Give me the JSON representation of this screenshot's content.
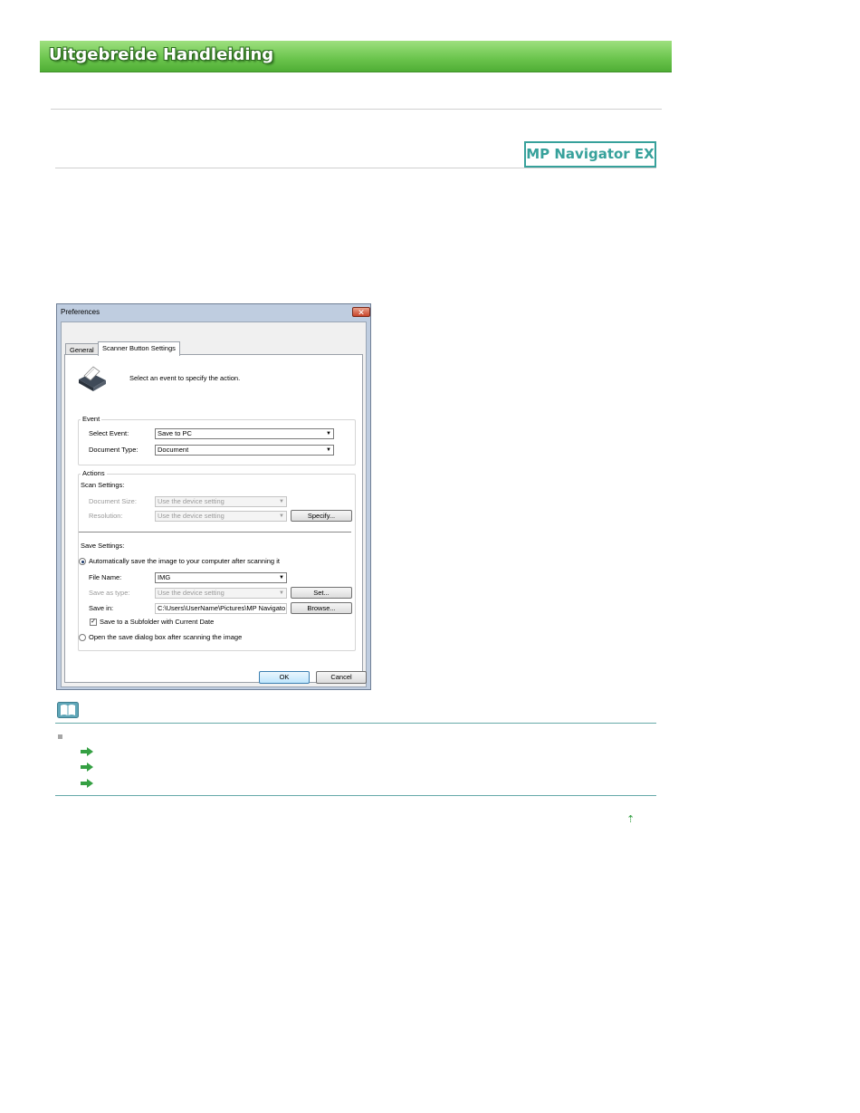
{
  "header": {
    "title": "Uitgebreide Handleiding"
  },
  "badge": {
    "label": "MP Navigator EX"
  },
  "dialog": {
    "title": "Preferences",
    "close_label": "✕",
    "tabs": [
      "General",
      "Scanner Button Settings"
    ],
    "prompt": "Select an event to specify the action.",
    "event": {
      "group_label": "Event",
      "select_event_label": "Select Event:",
      "select_event_value": "Save to PC",
      "document_type_label": "Document Type:",
      "document_type_value": "Document"
    },
    "actions": {
      "group_label": "Actions",
      "scan_settings_label": "Scan Settings:",
      "document_size_label": "Document Size:",
      "document_size_value": "Use the device setting",
      "resolution_label": "Resolution:",
      "resolution_value": "Use the device setting",
      "specify_button": "Specify...",
      "save_settings_label": "Save Settings:",
      "auto_save_label": "Automatically save the image to your computer after scanning it",
      "file_name_label": "File Name:",
      "file_name_value": "IMG",
      "save_as_type_label": "Save as type:",
      "save_as_type_value": "Use the device setting",
      "set_button": "Set...",
      "save_in_label": "Save in:",
      "save_in_value": "C:\\Users\\UserName\\Pictures\\MP Navigato",
      "browse_button": "Browse...",
      "subfolder_label": "Save to a Subfolder with Current Date",
      "open_dialog_label": "Open the save dialog box after scanning the image"
    },
    "ok_button": "OK",
    "cancel_button": "Cancel"
  },
  "colors": {
    "banner_green": "#6dc64f",
    "badge_teal": "#37a19b",
    "arrow_green": "#35a043",
    "rule_teal": "#66aaa9"
  },
  "top_link": {
    "label": "⇡"
  }
}
